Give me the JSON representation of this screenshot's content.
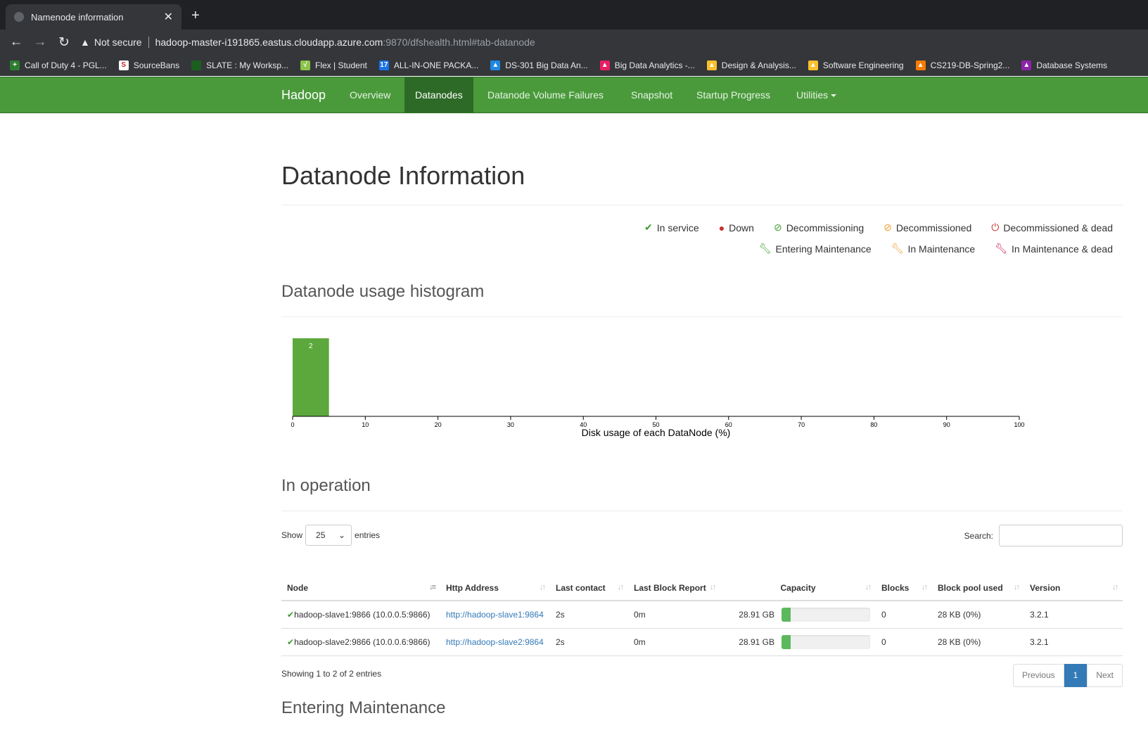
{
  "browser": {
    "tab_title": "Namenode information",
    "tab_close": "✕",
    "new_tab": "+",
    "security_label": "Not secure",
    "url_host": "hadoop-master-i191865.eastus.cloudapp.azure.com",
    "url_path": ":9870/dfshealth.html#tab-datanode",
    "bookmarks": [
      {
        "label": "Call of Duty 4 - PGL...",
        "color": "#2e7d32",
        "glyph": "+"
      },
      {
        "label": "SourceBans",
        "color": "#ffffff",
        "glyph": "S"
      },
      {
        "label": "SLATE : My Worksp...",
        "color": "#1b5e20",
        "glyph": ""
      },
      {
        "label": "Flex | Student",
        "color": "#8bc34a",
        "glyph": "√"
      },
      {
        "label": "ALL-IN-ONE PACKA...",
        "color": "#1a73e8",
        "glyph": "17"
      },
      {
        "label": "DS-301 Big Data An...",
        "color": "#1e88e5",
        "glyph": "▲"
      },
      {
        "label": "Big Data Analytics -...",
        "color": "#e91e63",
        "glyph": "▲"
      },
      {
        "label": "Design & Analysis...",
        "color": "#fbc02d",
        "glyph": "▲"
      },
      {
        "label": "Software Engineering",
        "color": "#fbc02d",
        "glyph": "▲"
      },
      {
        "label": "CS219-DB-Spring2...",
        "color": "#f57c00",
        "glyph": "▲"
      },
      {
        "label": "Database Systems",
        "color": "#8e24aa",
        "glyph": "▲"
      }
    ]
  },
  "navbar": {
    "brand": "Hadoop",
    "items": [
      {
        "label": "Overview"
      },
      {
        "label": "Datanodes"
      },
      {
        "label": "Datanode Volume Failures"
      },
      {
        "label": "Snapshot"
      },
      {
        "label": "Startup Progress"
      },
      {
        "label": "Utilities"
      }
    ]
  },
  "page": {
    "title": "Datanode Information",
    "legend": {
      "in_service": "In service",
      "down": "Down",
      "decommissioning": "Decommissioning",
      "decommissioned": "Decommissioned",
      "decommissioned_dead": "Decommissioned & dead",
      "entering_maintenance": "Entering Maintenance",
      "in_maintenance": "In Maintenance",
      "in_maintenance_dead": "In Maintenance & dead"
    },
    "histogram_heading": "Datanode usage histogram",
    "in_operation_heading": "In operation",
    "show_label": "Show",
    "entries_value": "25",
    "entries_label": "entries",
    "search_label": "Search:",
    "showing_text": "Showing 1 to 2 of 2 entries",
    "pager": {
      "previous": "Previous",
      "current": "1",
      "next": "Next"
    },
    "entering_maintenance_heading": "Entering Maintenance"
  },
  "table": {
    "columns": [
      "Node",
      "Http Address",
      "Last contact",
      "Last Block Report",
      "Capacity",
      "Blocks",
      "Block pool used",
      "Version"
    ],
    "rows": [
      {
        "node": "hadoop-slave1:9866 (10.0.0.5:9866)",
        "http": "http://hadoop-slave1:9864",
        "last_contact": "2s",
        "last_block_report": "0m",
        "capacity": "28.91 GB",
        "usage_fraction": 0.1,
        "blocks": "0",
        "block_pool_used": "28 KB (0%)",
        "version": "3.2.1"
      },
      {
        "node": "hadoop-slave2:9866 (10.0.0.6:9866)",
        "http": "http://hadoop-slave2:9864",
        "last_contact": "2s",
        "last_block_report": "0m",
        "capacity": "28.91 GB",
        "usage_fraction": 0.1,
        "blocks": "0",
        "block_pool_used": "28 KB (0%)",
        "version": "3.2.1"
      }
    ]
  },
  "chart_data": {
    "type": "bar",
    "xlabel": "Disk usage of each DataNode (%)",
    "xlim": [
      0,
      100
    ],
    "xticks": [
      0,
      10,
      20,
      30,
      40,
      50,
      60,
      70,
      80,
      90,
      100
    ],
    "bins": [
      {
        "x0": 0,
        "x1": 5,
        "count": 2
      }
    ],
    "bar_color": "#5ca83c"
  }
}
